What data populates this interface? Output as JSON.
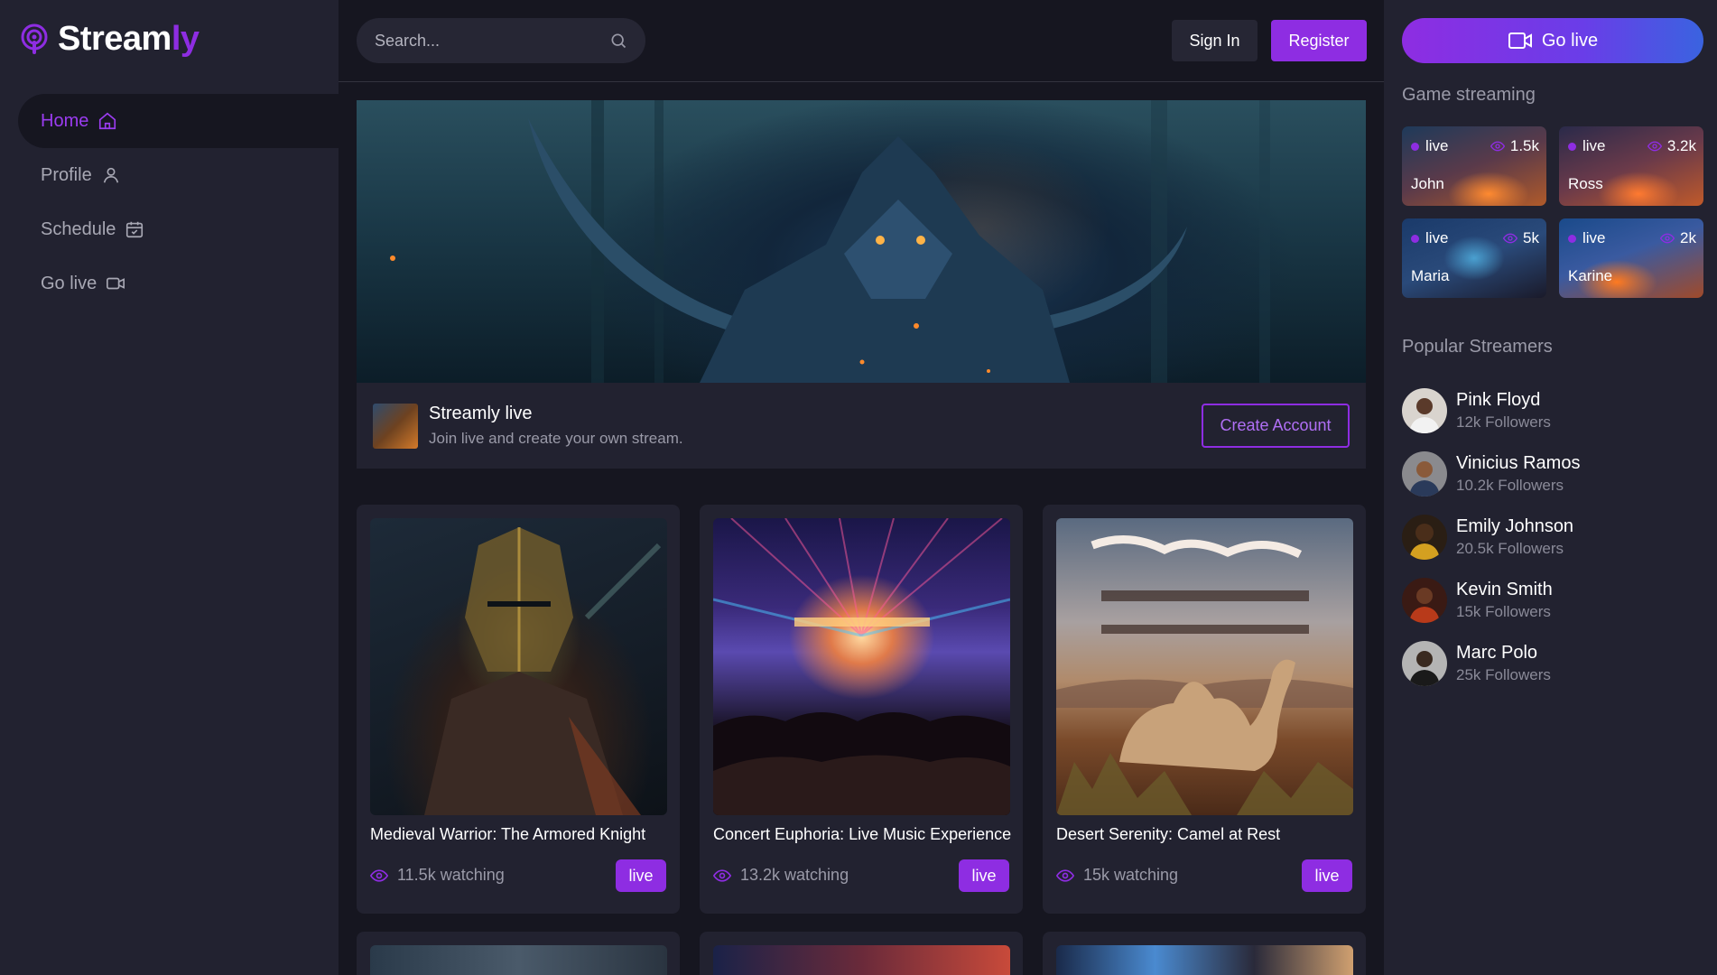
{
  "app": {
    "logo_main": "Stream",
    "logo_accent": "ly",
    "accent_color": "#8e2de2"
  },
  "nav": {
    "items": [
      {
        "label": "Home",
        "icon": "home-icon",
        "active": true
      },
      {
        "label": "Profile",
        "icon": "user-icon",
        "active": false
      },
      {
        "label": "Schedule",
        "icon": "calendar-icon",
        "active": false
      },
      {
        "label": "Go live",
        "icon": "video-icon",
        "active": false
      }
    ]
  },
  "topbar": {
    "search_placeholder": "Search...",
    "signin_label": "Sign In",
    "register_label": "Register"
  },
  "hero": {
    "title": "Streamly live",
    "subtitle": "Join live and create your own stream.",
    "cta_label": "Create Account"
  },
  "streams": [
    {
      "title": "Medieval Warrior: The Armored Knight",
      "watching": "11.5k watching",
      "badge": "live"
    },
    {
      "title": "Concert Euphoria: Live Music Experience",
      "watching": "13.2k watching",
      "badge": "live"
    },
    {
      "title": "Desert Serenity: Camel at Rest",
      "watching": "15k watching",
      "badge": "live"
    }
  ],
  "right": {
    "golive_label": "Go live",
    "game_section_title": "Game streaming",
    "games": [
      {
        "status": "live",
        "views": "1.5k",
        "name": "John"
      },
      {
        "status": "live",
        "views": "3.2k",
        "name": "Ross"
      },
      {
        "status": "live",
        "views": "5k",
        "name": "Maria"
      },
      {
        "status": "live",
        "views": "2k",
        "name": "Karine"
      }
    ],
    "popular_section_title": "Popular Streamers",
    "streamers": [
      {
        "name": "Pink Floyd",
        "followers": "12k Followers"
      },
      {
        "name": "Vinicius Ramos",
        "followers": "10.2k Followers"
      },
      {
        "name": "Emily Johnson",
        "followers": "20.5k Followers"
      },
      {
        "name": "Kevin Smith",
        "followers": "15k Followers"
      },
      {
        "name": "Marc Polo",
        "followers": "25k Followers"
      }
    ]
  }
}
